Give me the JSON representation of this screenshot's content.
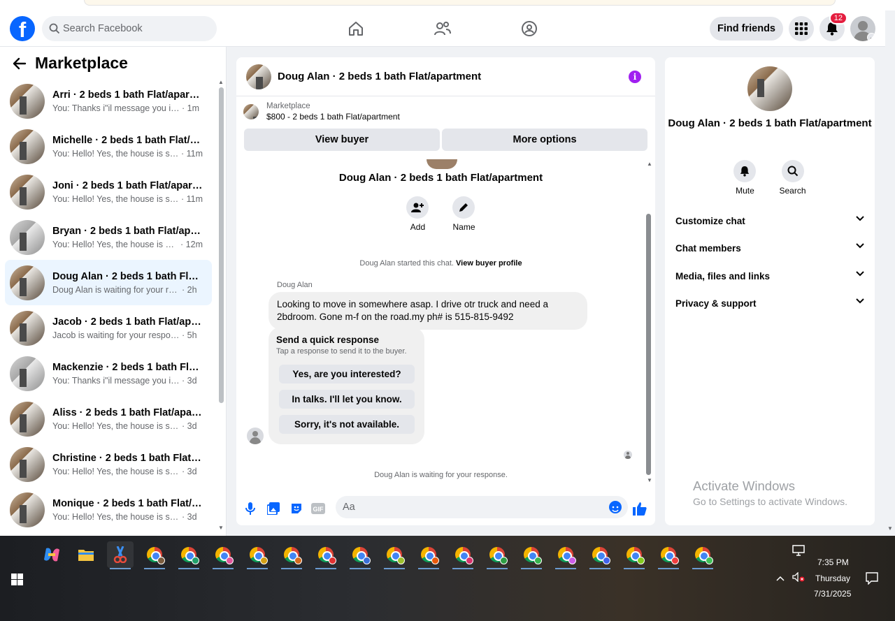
{
  "topbar": {
    "logo_letter": "f",
    "search_placeholder": "Search Facebook",
    "find_friends": "Find friends",
    "notification_count": "12"
  },
  "marketplace": {
    "title": "Marketplace",
    "conversations": [
      {
        "name": "Arri · 2 beds 1 bath Flat/apartm...",
        "preview": "You: Thanks i\"il message you in a ...",
        "time": "· 1m"
      },
      {
        "name": "Michelle · 2 beds 1 bath Flat/apa...",
        "preview": "You: Hello! Yes, the house is still a...",
        "time": "· 11m"
      },
      {
        "name": "Joni · 2 beds 1 bath Flat/apartm...",
        "preview": "You: Hello! Yes, the house is still a...",
        "time": "· 11m"
      },
      {
        "name": "Bryan · 2 beds 1 bath Flat/apart...",
        "preview": "You: Hello! Yes, the house is still a...",
        "time": "· 12m"
      },
      {
        "name": "Doug Alan · 2 beds 1 bath Flat/a...",
        "preview": "Doug Alan is waiting for your resp...",
        "time": "· 2h"
      },
      {
        "name": "Jacob · 2 beds 1 bath Flat/apart...",
        "preview": "Jacob is waiting for your response.",
        "time": "· 5h"
      },
      {
        "name": "Mackenzie · 2 beds 1 bath Flat/a...",
        "preview": "You: Thanks i\"il message you in a ...",
        "time": "· 3d"
      },
      {
        "name": "Aliss · 2 beds 1 bath Flat/apartm...",
        "preview": "You: Hello! Yes, the house is still av...",
        "time": "· 3d"
      },
      {
        "name": "Christine · 2 beds 1 bath Flat/ap...",
        "preview": "You: Hello! Yes, the house is still av...",
        "time": "· 3d"
      },
      {
        "name": "Monique · 2 beds 1 bath Flat/ap...",
        "preview": "You: Hello! Yes, the house is still av...",
        "time": "· 3d"
      }
    ]
  },
  "chat": {
    "header_title": "Doug Alan · 2 beds 1 bath Flat/apartment",
    "listing_source": "Marketplace",
    "listing_price": "$800 - 2 beds 1 bath Flat/apartment",
    "view_buyer": "View buyer",
    "more_options": "More options",
    "body_title": "Doug Alan · 2 beds 1 bath Flat/apartment",
    "add_label": "Add",
    "name_label": "Name",
    "started_text": "Doug Alan started this chat.",
    "view_buyer_profile": "View buyer profile",
    "sender": "Doug Alan",
    "message": "Looking to move in somewhere asap. I drive otr truck and need a 2bdroom. Gone m-f on the road.my ph# is 515-815-9492",
    "quick_title": "Send a quick response",
    "quick_sub": "Tap a response to send it to the buyer.",
    "quick_responses": [
      "Yes, are you interested?",
      "In talks. I'll let you know.",
      "Sorry, it's not available."
    ],
    "waiting": "Doug Alan is waiting for your response.",
    "composer_placeholder": "Aa"
  },
  "info": {
    "name": "Doug Alan · 2 beds 1 bath Flat/apartment",
    "mute": "Mute",
    "search": "Search",
    "rows": [
      "Customize chat",
      "Chat members",
      "Media, files and links",
      "Privacy & support"
    ],
    "activate_title": "Activate Windows",
    "activate_sub": "Go to Settings to activate Windows."
  },
  "taskbar": {
    "time": "7:35 PM",
    "day": "Thursday",
    "date": "7/31/2025",
    "profile_colors": [
      "#7a5c3e",
      "#22a06b",
      "#e0559a",
      "#d4a017",
      "#d46a1e",
      "#e03131",
      "#3b6fd6",
      "#9bbf2d",
      "#e8590c",
      "#d6336c",
      "#2f9e44",
      "#37b24d",
      "#cc5de8",
      "#4263eb",
      "#82c91e",
      "#f03e3e",
      "#40c057"
    ]
  },
  "colors": {
    "brand_blue": "#0866ff",
    "info_purple": "#a020f0",
    "badge_red": "#e41e3f",
    "active_row": "#ebf5ff"
  }
}
